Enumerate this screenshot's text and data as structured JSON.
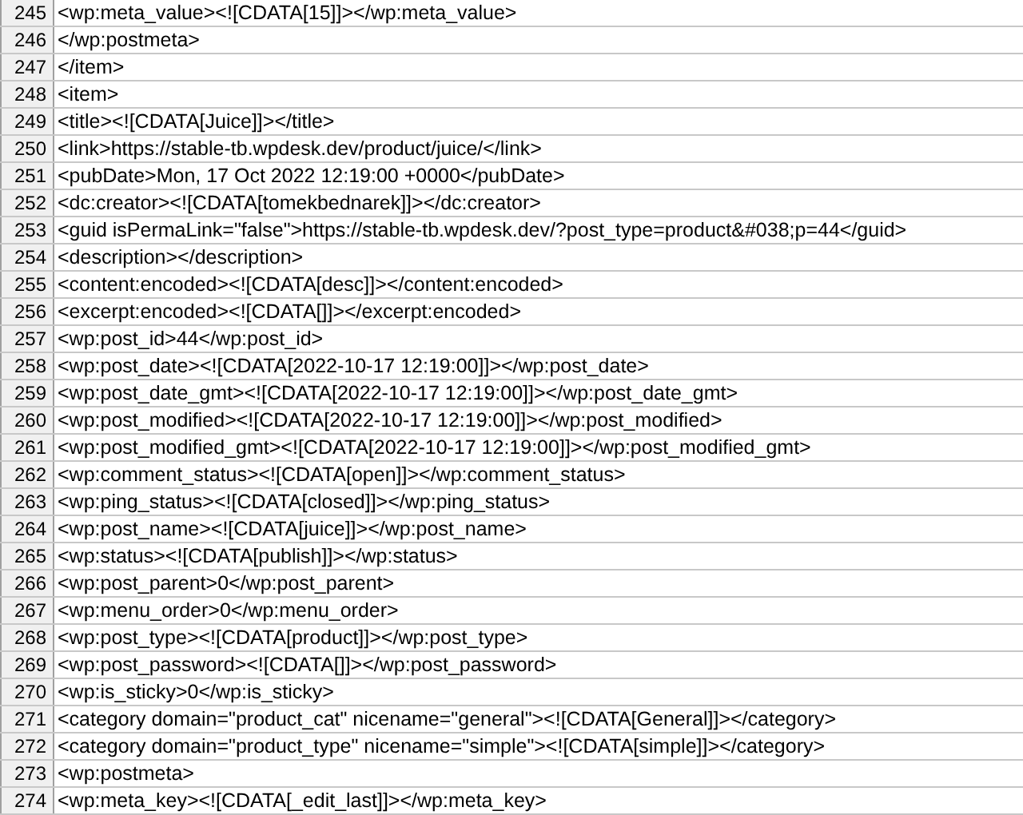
{
  "rows": [
    {
      "line": "245",
      "text": "<wp:meta_value><![CDATA[15]]></wp:meta_value>"
    },
    {
      "line": "246",
      "text": "</wp:postmeta>"
    },
    {
      "line": "247",
      "text": "</item>"
    },
    {
      "line": "248",
      "text": "<item>"
    },
    {
      "line": "249",
      "text": "<title><![CDATA[Juice]]></title>"
    },
    {
      "line": "250",
      "text": "<link>https://stable-tb.wpdesk.dev/product/juice/</link>"
    },
    {
      "line": "251",
      "text": "<pubDate>Mon, 17 Oct 2022 12:19:00 +0000</pubDate>"
    },
    {
      "line": "252",
      "text": "<dc:creator><![CDATA[tomekbednarek]]></dc:creator>"
    },
    {
      "line": "253",
      "text": "<guid isPermaLink=\"false\">https://stable-tb.wpdesk.dev/?post_type=product&#038;p=44</guid>"
    },
    {
      "line": "254",
      "text": "<description></description>"
    },
    {
      "line": "255",
      "text": "<content:encoded><![CDATA[desc]]></content:encoded>"
    },
    {
      "line": "256",
      "text": "<excerpt:encoded><![CDATA[]]></excerpt:encoded>"
    },
    {
      "line": "257",
      "text": "<wp:post_id>44</wp:post_id>"
    },
    {
      "line": "258",
      "text": "<wp:post_date><![CDATA[2022-10-17 12:19:00]]></wp:post_date>"
    },
    {
      "line": "259",
      "text": "<wp:post_date_gmt><![CDATA[2022-10-17 12:19:00]]></wp:post_date_gmt>"
    },
    {
      "line": "260",
      "text": "<wp:post_modified><![CDATA[2022-10-17 12:19:00]]></wp:post_modified>"
    },
    {
      "line": "261",
      "text": "<wp:post_modified_gmt><![CDATA[2022-10-17 12:19:00]]></wp:post_modified_gmt>"
    },
    {
      "line": "262",
      "text": "<wp:comment_status><![CDATA[open]]></wp:comment_status>"
    },
    {
      "line": "263",
      "text": "<wp:ping_status><![CDATA[closed]]></wp:ping_status>"
    },
    {
      "line": "264",
      "text": "<wp:post_name><![CDATA[juice]]></wp:post_name>"
    },
    {
      "line": "265",
      "text": "<wp:status><![CDATA[publish]]></wp:status>"
    },
    {
      "line": "266",
      "text": "<wp:post_parent>0</wp:post_parent>"
    },
    {
      "line": "267",
      "text": "<wp:menu_order>0</wp:menu_order>"
    },
    {
      "line": "268",
      "text": "<wp:post_type><![CDATA[product]]></wp:post_type>"
    },
    {
      "line": "269",
      "text": "<wp:post_password><![CDATA[]]></wp:post_password>"
    },
    {
      "line": "270",
      "text": "<wp:is_sticky>0</wp:is_sticky>"
    },
    {
      "line": "271",
      "text": "<category domain=\"product_cat\" nicename=\"general\"><![CDATA[General]]></category>"
    },
    {
      "line": "272",
      "text": "<category domain=\"product_type\" nicename=\"simple\"><![CDATA[simple]]></category>"
    },
    {
      "line": "273",
      "text": "<wp:postmeta>"
    },
    {
      "line": "274",
      "text": "<wp:meta_key><![CDATA[_edit_last]]></wp:meta_key>"
    }
  ]
}
